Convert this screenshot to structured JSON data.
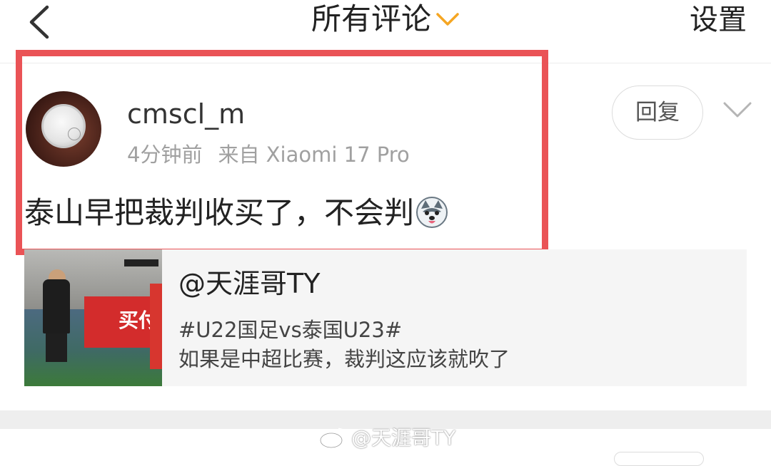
{
  "header": {
    "title": "所有评论",
    "settings_label": "设置"
  },
  "comment": {
    "username": "cmscl_m",
    "time": "4分钟前",
    "source": "来自 Xiaomi 17 Pro",
    "reply_label": "回复",
    "text": "泰山早把裁判收买了，不会判"
  },
  "repost": {
    "thumbnail_caption": "买付",
    "mention": "@天涯哥TY",
    "tag": "#U22国足vs泰国U23#",
    "description": "如果是中超比赛，裁判这应该就吹了"
  },
  "watermark": {
    "text": "@天涯哥TY"
  },
  "colors": {
    "accent_orange": "#f5a623",
    "highlight_red": "#ea5356",
    "card_background": "#f5f5f5"
  },
  "icons": {
    "back": "chevron-left-icon",
    "title_caret": "chevron-down-icon",
    "more": "chevron-down-icon",
    "emoji": "husky-dog-emoji-icon",
    "watermark_logo": "weibo-logo-icon"
  }
}
